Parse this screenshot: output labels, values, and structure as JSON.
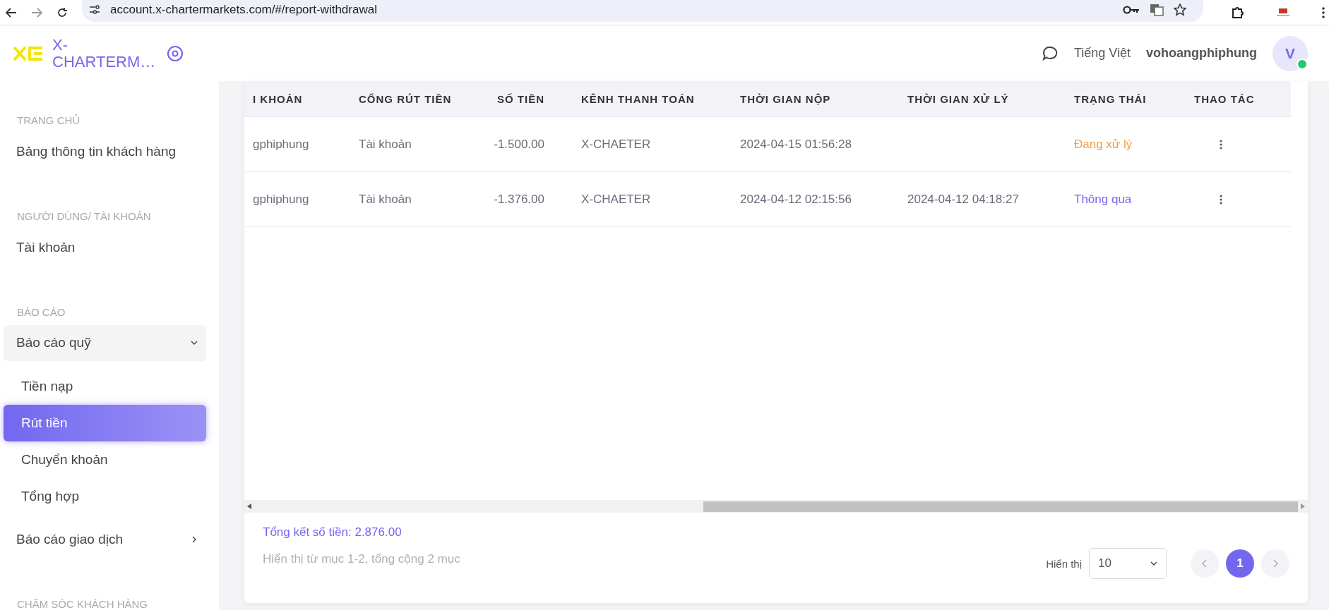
{
  "browser": {
    "url": "account.x-chartermarkets.com/#/report-withdrawal"
  },
  "brand": {
    "name": "X-CHARTERM…"
  },
  "header": {
    "language": "Tiếng Việt",
    "username": "vohoangphiphung",
    "avatar": "V",
    "online": true
  },
  "sidebar": [
    {
      "heading": "TRANG CHỦ",
      "items": [
        {
          "label": "Bảng thông tin khách hàng",
          "selected": false
        }
      ]
    },
    {
      "heading": "NGƯỜI DÙNG/ TÀI KHOẢN",
      "items": [
        {
          "label": "Tài khoản",
          "selected": false
        }
      ]
    },
    {
      "heading": "BÁO CÁO",
      "items": [
        {
          "label": "Báo cáo quỹ",
          "selected": false,
          "expanded": true,
          "children": [
            {
              "label": "Tiền nạp",
              "selected": false
            },
            {
              "label": "Rút tiền",
              "selected": true
            },
            {
              "label": "Chuyển khoản",
              "selected": false
            },
            {
              "label": "Tổng hợp",
              "selected": false
            }
          ]
        },
        {
          "label": "Báo cáo giao dịch",
          "selected": false,
          "expanded": false
        }
      ]
    },
    {
      "heading": "CHĂM SÓC KHÁCH HÀNG"
    }
  ],
  "table": {
    "columns": [
      "I KHOẢN",
      "CỔNG RÚT TIỀN",
      "SỐ TIỀN",
      "KÊNH THANH TOÁN",
      "THỜI GIAN NỘP",
      "THỜI GIAN XỬ LÝ",
      "TRẠNG THÁI",
      "THAO TÁC"
    ],
    "rows": [
      {
        "account": "gphiphung",
        "gateway": "Tài khoản",
        "amount": "-1.500.00",
        "channel": "X-CHAETER",
        "submitted": "2024-04-15 01:56:28",
        "processed": null,
        "status": "Đang xử lý",
        "color": "#f0a040"
      },
      {
        "account": "gphiphung",
        "gateway": "Tài khoản",
        "amount": "-1.376.00",
        "channel": "X-CHAETER",
        "submitted": "2024-04-12 02:15:56",
        "processed": "2024-04-12 04:18:27",
        "status": "Thông qua",
        "color": "#7367f0"
      }
    ]
  },
  "footer": {
    "total_label": "Tổng kết số tiền:",
    "total": "2.876.00",
    "summary": "Hiển thị từ mục 1-2, tổng cộng 2 mục",
    "page_size_label": "Hiển thị",
    "page_size": "10",
    "pages": [
      {
        "label": "1",
        "selected": true
      }
    ]
  }
}
